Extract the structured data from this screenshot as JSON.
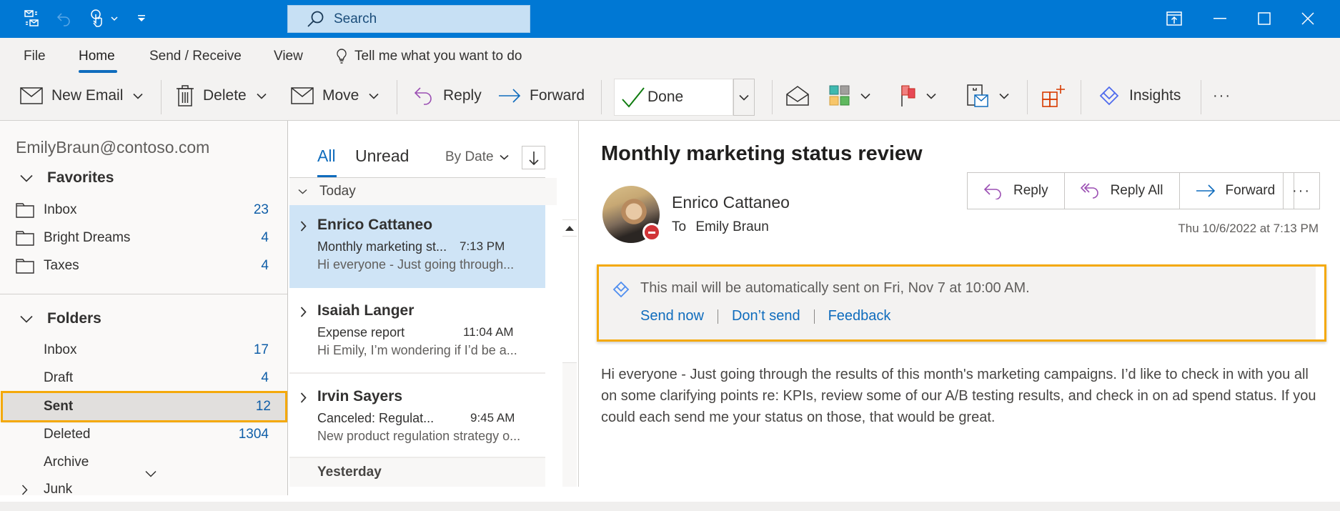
{
  "titlebar": {
    "search_placeholder": "Search",
    "icons": [
      "send-receive-all-icon",
      "undo-icon",
      "touch-mode-icon",
      "customize-toolbar-icon"
    ],
    "window_buttons": [
      "coming-soon-icon",
      "minimize-icon",
      "maximize-icon",
      "close-icon"
    ],
    "accent_color": "#0078d4"
  },
  "ribbon": {
    "tabs": [
      {
        "label": "File"
      },
      {
        "label": "Home",
        "active": true
      },
      {
        "label": "Send / Receive"
      },
      {
        "label": "View"
      }
    ],
    "tell_me": "Tell me what you want to do",
    "commands": {
      "new_email": "New Email",
      "delete": "Delete",
      "move": "Move",
      "reply": "Reply",
      "forward": "Forward",
      "quick_step": "Done",
      "insights": "Insights",
      "more": "···"
    }
  },
  "left_pane": {
    "account": "EmilyBraun@contoso.com",
    "favorites": {
      "label": "Favorites",
      "items": [
        {
          "name": "Inbox",
          "count": "23"
        },
        {
          "name": "Bright Dreams",
          "count": "4"
        },
        {
          "name": "Taxes",
          "count": "4"
        }
      ]
    },
    "folders": {
      "label": "Folders",
      "items": [
        {
          "name": "Inbox",
          "count": "17"
        },
        {
          "name": "Draft",
          "count": "4"
        },
        {
          "name": "Sent",
          "count": "12",
          "selected": true
        },
        {
          "name": "Deleted",
          "count": "1304"
        },
        {
          "name": "Archive",
          "count": ""
        },
        {
          "name": "Junk",
          "count": ""
        }
      ]
    }
  },
  "message_list": {
    "tabs": [
      {
        "label": "All",
        "active": true
      },
      {
        "label": "Unread"
      }
    ],
    "sort_label": "By Date",
    "groups": [
      {
        "label": "Today",
        "messages": [
          {
            "from": "Enrico Cattaneo",
            "subject": "Monthly marketing st...",
            "time": "7:13 PM",
            "preview": "Hi everyone - Just going through...",
            "selected": true
          },
          {
            "from": "Isaiah Langer",
            "subject": "Expense report",
            "time": "11:04 AM",
            "preview": "Hi Emily, I’m wondering if I’d be a..."
          },
          {
            "from": "Irvin Sayers",
            "subject": "Canceled: Regulat...",
            "time": "9:45 AM",
            "preview": "New product regulation strategy o..."
          }
        ]
      },
      {
        "label": "Yesterday",
        "messages": []
      }
    ]
  },
  "reading_pane": {
    "subject": "Monthly marketing status review",
    "sender": "Enrico Cattaneo",
    "to_label": "To",
    "recipient": "Emily Braun",
    "presence": "do-not-disturb",
    "actions": {
      "reply": "Reply",
      "reply_all": "Reply All",
      "forward": "Forward",
      "more": "···"
    },
    "date": "Thu 10/6/2022 at 7:13 PM",
    "autosend": {
      "message": "This mail will be automatically sent on Fri, Nov 7 at 10:00 AM.",
      "links": [
        "Send now",
        "Don’t send",
        "Feedback"
      ]
    },
    "body": "Hi everyone - Just going through the results of this month's marketing campaigns. I’d like to check in with you all on some clarifying points re: KPIs, review some of our A/B testing results, and check in on ad spend status. If you could each send me your status on those, that would be great."
  },
  "highlight_color": "#f4a90a",
  "link_color": "#0f6cbd"
}
